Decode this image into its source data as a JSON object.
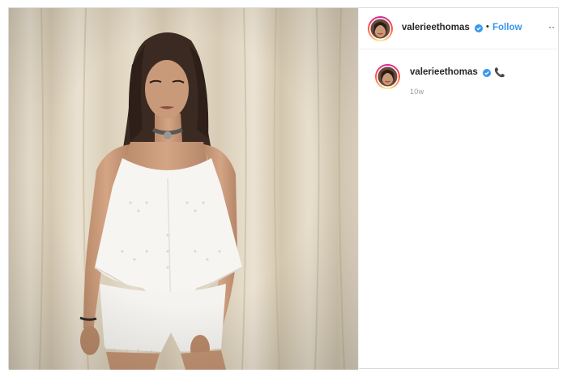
{
  "post": {
    "header": {
      "username": "valerieethomas",
      "separator": "•",
      "follow_label": "Follow",
      "more_label": "··"
    },
    "caption": {
      "username": "valerieethomas",
      "emoji": "📞",
      "time_ago": "10w"
    },
    "photo": {
      "icon": "photo-of-woman-in-white-top",
      "colors": {
        "curtain": "#e2d7c3",
        "outfit": "#f7f7f5"
      }
    },
    "icons": {
      "verified": "verified-badge-icon",
      "avatar": "profile-avatar"
    },
    "colors": {
      "accent": "#3897f0",
      "verified": "#3897f0",
      "text": "#262626",
      "muted": "#999999"
    }
  }
}
